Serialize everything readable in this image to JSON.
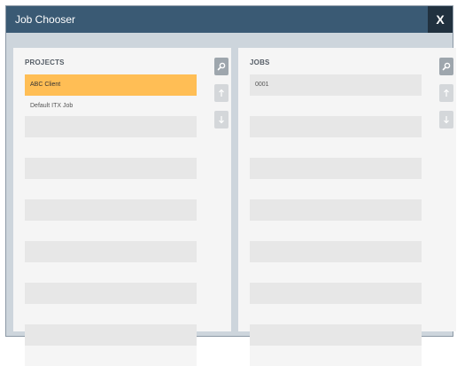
{
  "window": {
    "title": "Job Chooser",
    "close_label": "X"
  },
  "projects": {
    "heading": "PROJECTS",
    "items": [
      "ABC Client",
      "Default ITX Job",
      "",
      "",
      "",
      "",
      "",
      "",
      "",
      "",
      "",
      "",
      "",
      ""
    ],
    "selected_index": 0
  },
  "jobs": {
    "heading": "JOBS",
    "items": [
      "0001",
      "",
      "",
      "",
      "",
      "",
      "",
      "",
      "",
      "",
      "",
      "",
      "",
      ""
    ],
    "selected_index": -1
  },
  "icons": {
    "search": "search-icon",
    "move_up": "arrow-up-icon",
    "move_down": "arrow-down-icon"
  },
  "colors": {
    "titlebar": "#3a5a74",
    "close_button": "#21313f",
    "selected_row": "#ffbe55",
    "row_stripe": "#e7e7e7"
  }
}
